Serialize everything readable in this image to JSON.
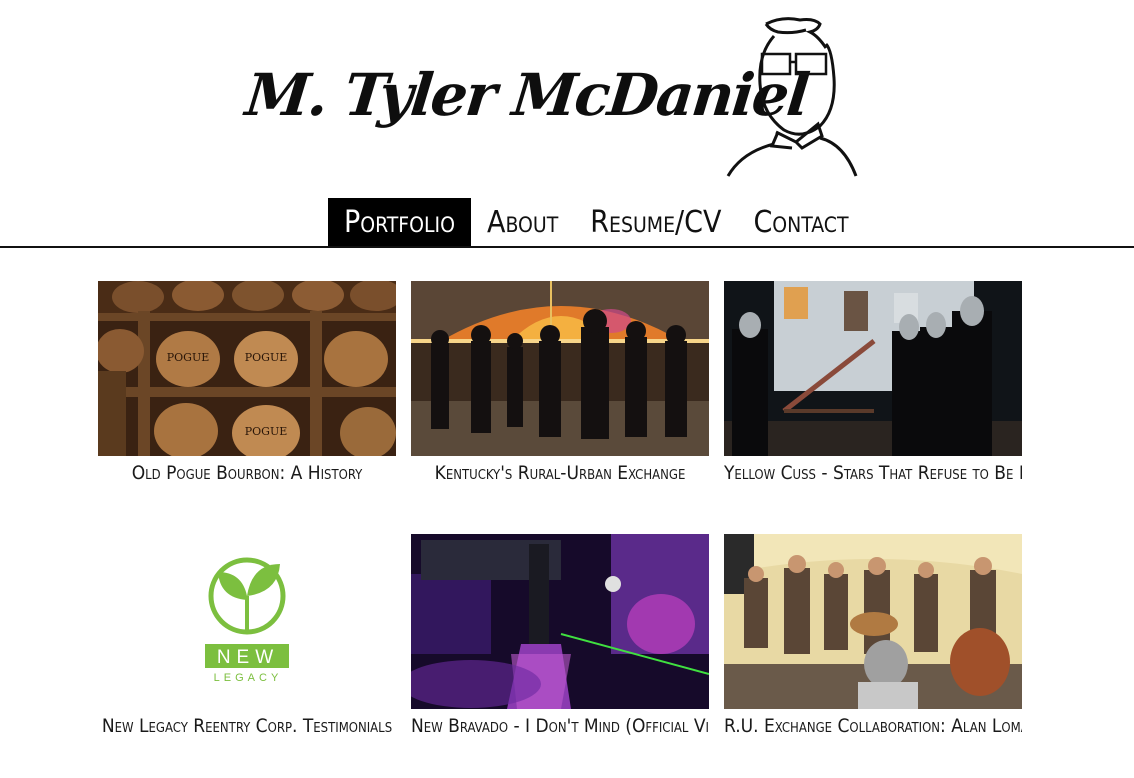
{
  "site": {
    "title": "M. Tyler McDaniel"
  },
  "nav": {
    "items": [
      {
        "label": "Portfolio",
        "active": true
      },
      {
        "label": "About",
        "active": false
      },
      {
        "label": "Resume/CV",
        "active": false
      },
      {
        "label": "Contact",
        "active": false
      }
    ]
  },
  "portfolio": {
    "items": [
      {
        "caption": "Old Pogue Bourbon: A History",
        "thumbnail": "bourbon-barrels-photo"
      },
      {
        "caption": "Kentucky's Rural-Urban Exchange",
        "thumbnail": "tent-circle-dance-photo"
      },
      {
        "caption": "Yellow Cuss - Stars That Refuse to Be Found",
        "thumbnail": "night-porch-band-photo"
      },
      {
        "caption": "New Legacy Reentry Corp. Testimonials",
        "thumbnail": "new-legacy-logo"
      },
      {
        "caption": "New Bravado - I Don't Mind (Official Video)",
        "thumbnail": "purple-stage-lights-photo"
      },
      {
        "caption": "R.U. Exchange Collaboration: Alan Lomax",
        "thumbnail": "tent-stage-musicians-photo"
      }
    ]
  },
  "logo": {
    "word_top": "NEW",
    "word_bottom": "LEGACY",
    "color": "#7cbf3f"
  },
  "barrel_stamp": "POGUE",
  "colors": {
    "nav_active_bg": "#000000",
    "nav_active_text": "#ffffff",
    "rule": "#111111"
  }
}
